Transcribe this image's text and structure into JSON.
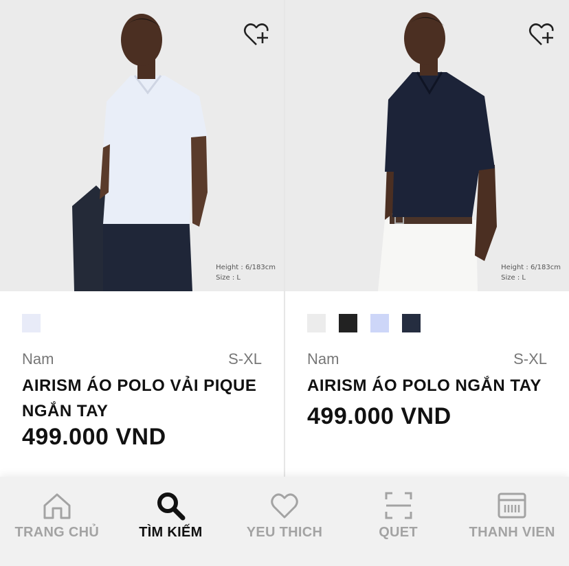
{
  "products": [
    {
      "model_info": [
        "Height : 6/183cm",
        "Size : L"
      ],
      "swatches": [
        "#e8ebf8"
      ],
      "gender": "Nam",
      "sizes": "S-XL",
      "name_line1": "AIRISM ÁO POLO VẢI PIQUE",
      "name_line2": "NGẮN TAY",
      "price": "499.000 VND",
      "wishlist_icon": "heart-plus-icon",
      "shirt_color": "#e9eef8"
    },
    {
      "model_info": [
        "Height : 6/183cm",
        "Size : L"
      ],
      "swatches": [
        "#ececec",
        "#222222",
        "#cdd6f8",
        "#252d40"
      ],
      "gender": "Nam",
      "sizes": "S-XL",
      "name_line1": "AIRISM ÁO POLO NGẮN TAY",
      "name_line2": "",
      "price": "499.000 VND",
      "wishlist_icon": "heart-plus-icon",
      "shirt_color": "#1c2338"
    }
  ],
  "nav": [
    {
      "label": "TRANG CHỦ",
      "icon": "home-icon",
      "active": false
    },
    {
      "label": "TÌM KIẾM",
      "icon": "search-icon",
      "active": true
    },
    {
      "label": "YEU THICH",
      "icon": "heart-icon",
      "active": false
    },
    {
      "label": "QUET",
      "icon": "scan-icon",
      "active": false
    },
    {
      "label": "THANH VIEN",
      "icon": "member-card-icon",
      "active": false
    }
  ]
}
